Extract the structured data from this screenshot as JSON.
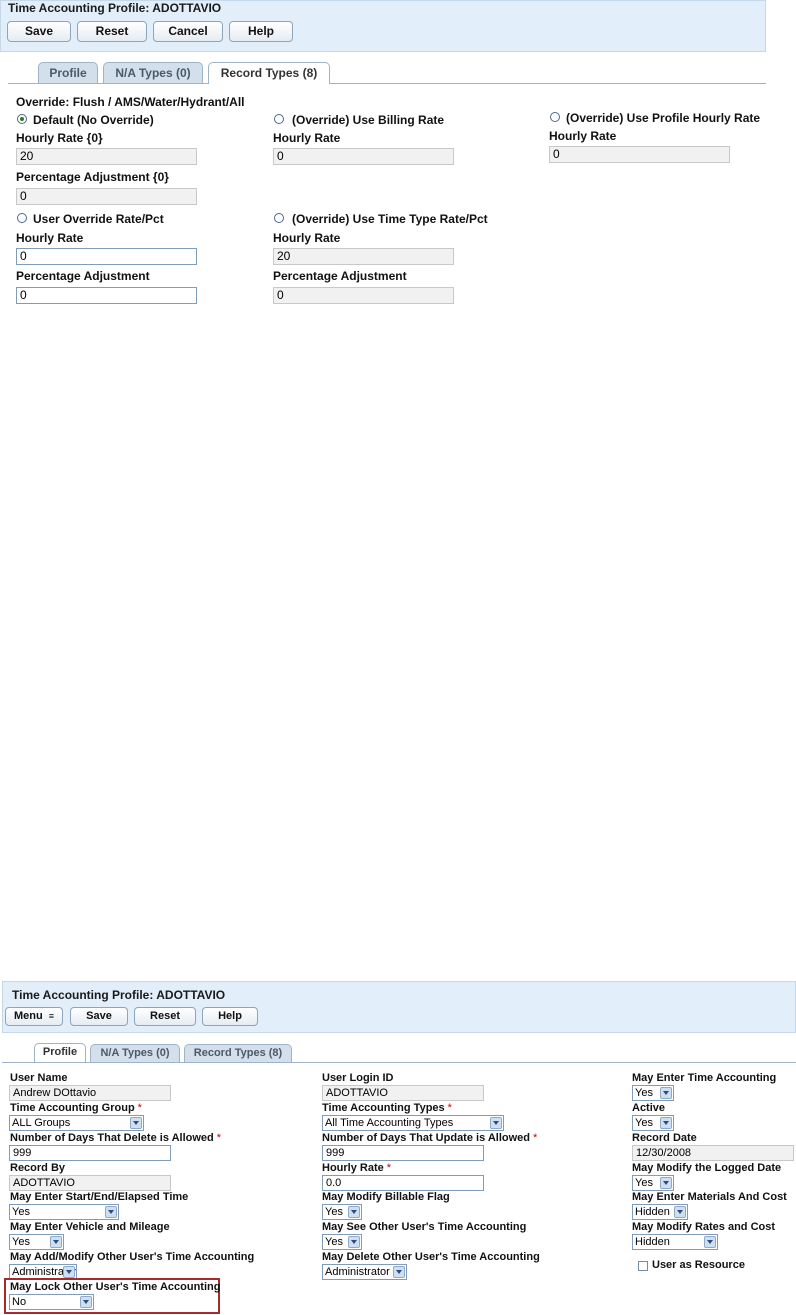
{
  "top": {
    "title": "Time Accounting Profile: ADOTTAVIO",
    "buttons": {
      "save": "Save",
      "reset": "Reset",
      "cancel": "Cancel",
      "help": "Help"
    },
    "tabs": {
      "profile": "Profile",
      "na_types": "N/A Types (0)",
      "record_types": "Record Types (8)"
    },
    "override_title": "Override: Flush / AMS/Water/Hydrant/All",
    "col1": {
      "radio_default": "Default (No Override)",
      "hourly_label": "Hourly Rate {0}",
      "hourly_value": "20",
      "pct_label": "Percentage Adjustment {0}",
      "pct_value": "0",
      "radio_user": "User Override Rate/Pct",
      "user_hourly_label": "Hourly Rate",
      "user_hourly_value": "0",
      "user_pct_label": "Percentage Adjustment",
      "user_pct_value": "0"
    },
    "col2": {
      "radio_billing": "(Override) Use Billing Rate",
      "hourly_label": "Hourly Rate",
      "hourly_value": "0",
      "radio_timetype": "(Override) Use Time Type Rate/Pct",
      "tt_hourly_label": "Hourly Rate",
      "tt_hourly_value": "20",
      "tt_pct_label": "Percentage Adjustment",
      "tt_pct_value": "0"
    },
    "col3": {
      "radio_profile": "(Override) Use Profile Hourly Rate",
      "hourly_label": "Hourly Rate",
      "hourly_value": "0"
    }
  },
  "bottom": {
    "title": "Time Accounting Profile: ADOTTAVIO",
    "buttons": {
      "menu": "Menu",
      "save": "Save",
      "reset": "Reset",
      "help": "Help"
    },
    "tabs": {
      "profile": "Profile",
      "na_types": "N/A Types (0)",
      "record_types": "Record Types (8)"
    },
    "required_mark": "*",
    "c1": {
      "user_name_label": "User Name",
      "user_name_value": "Andrew  DOttavio",
      "group_label": "Time Accounting Group",
      "group_value": "ALL Groups",
      "delete_days_label": "Number of Days That Delete is Allowed",
      "delete_days_value": "999",
      "record_by_label": "Record By",
      "record_by_value": "ADOTTAVIO",
      "start_end_label": "May Enter Start/End/Elapsed Time",
      "start_end_value": "Yes",
      "vehicle_label": "May Enter Vehicle and Mileage",
      "vehicle_value": "Yes",
      "add_modify_label": "May Add/Modify Other User's Time Accounting",
      "add_modify_value": "Administrator",
      "lock_label": "May Lock Other User's Time Accounting",
      "lock_value": "No"
    },
    "c2": {
      "login_label": "User Login ID",
      "login_value": "ADOTTAVIO",
      "types_label": "Time Accounting Types",
      "types_value": "All Time Accounting Types",
      "update_days_label": "Number of Days That Update is Allowed",
      "update_days_value": "999",
      "hourly_label": "Hourly Rate",
      "hourly_value": "0.0",
      "billable_label": "May Modify Billable Flag",
      "billable_value": "Yes",
      "see_other_label": "May See Other User's Time Accounting",
      "see_other_value": "Yes",
      "delete_other_label": "May Delete Other User's Time Accounting",
      "delete_other_value": "Administrator"
    },
    "c3": {
      "enter_ta_label": "May Enter Time Accounting",
      "enter_ta_value": "Yes",
      "active_label": "Active",
      "active_value": "Yes",
      "record_date_label": "Record Date",
      "record_date_value": "12/30/2008",
      "logged_date_label": "May Modify the Logged Date",
      "logged_date_value": "Yes",
      "materials_label": "May Enter Materials And Cost",
      "materials_value": "Hidden",
      "rates_label": "May Modify Rates and Cost",
      "rates_value": "Hidden",
      "resource_label": "User as Resource"
    }
  }
}
